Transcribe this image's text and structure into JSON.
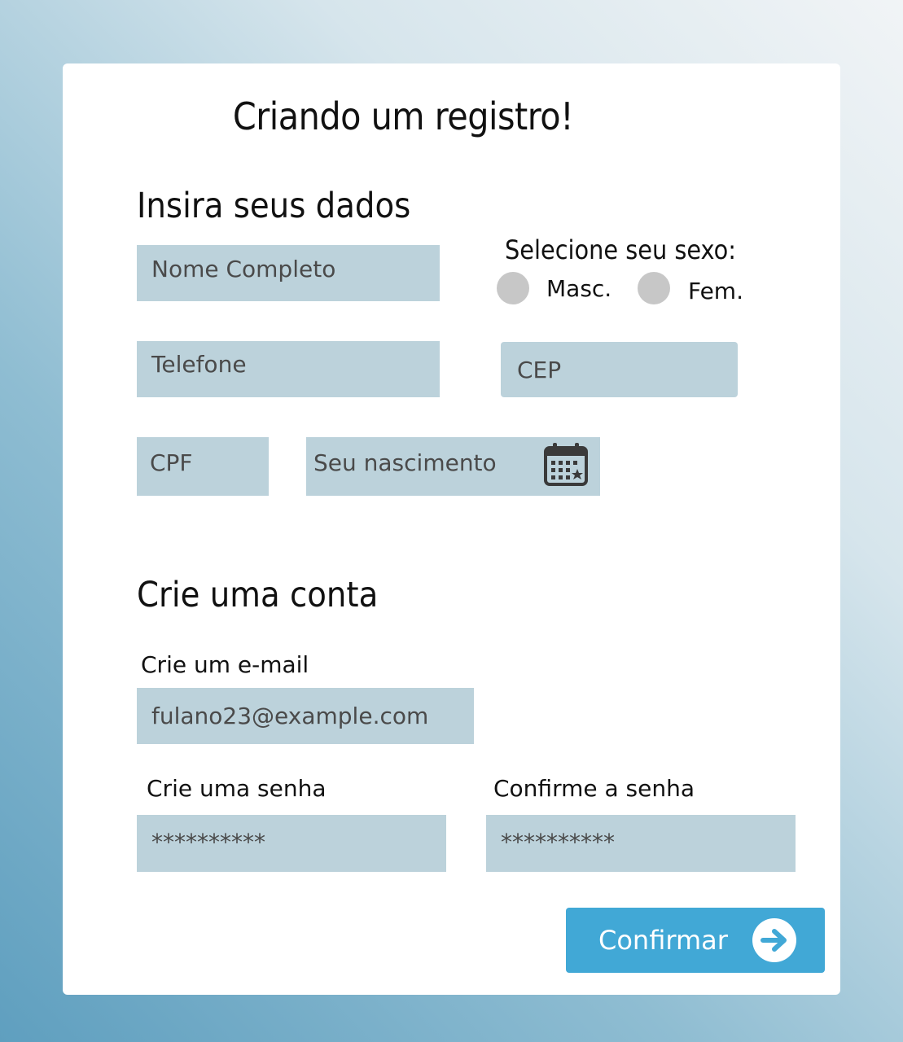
{
  "form": {
    "title": "Criando um registro!",
    "section_personal": "Insira seus dados",
    "name_placeholder": "Nome Completo",
    "sex_label": "Selecione seu sexo:",
    "sex_options": [
      "Masc.",
      "Fem."
    ],
    "phone_placeholder": "Telefone",
    "cep_placeholder": "CEP",
    "cpf_placeholder": "CPF",
    "birth_placeholder": "Seu nascimento",
    "birth_icon": "calendar-icon",
    "section_account": "Crie uma conta",
    "email_label": "Crie um e-mail",
    "email_value": "fulano23@example.com",
    "password_label": "Crie uma senha",
    "password_value": "**********",
    "confirm_label": "Confirme a senha",
    "confirm_value": "**********",
    "submit_label": "Confirmar",
    "submit_icon": "arrow-right-circle-icon"
  },
  "colors": {
    "field_bg": "#bcd2db",
    "button_bg": "#41a8d6",
    "radio": "#c7c7c7"
  }
}
